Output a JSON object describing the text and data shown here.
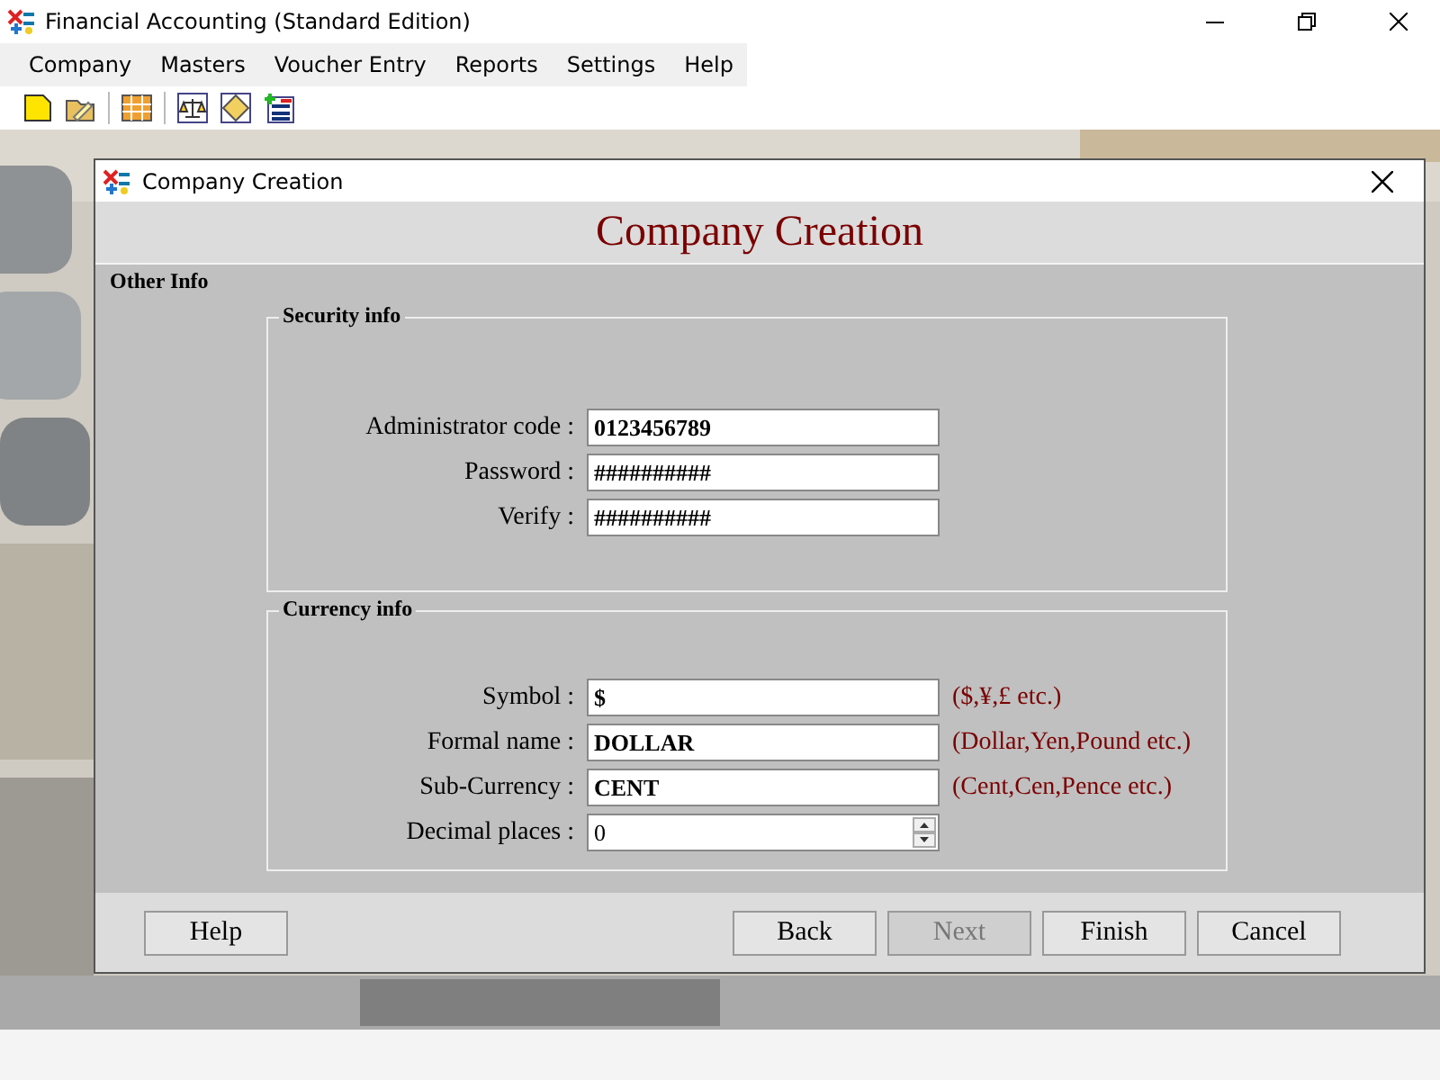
{
  "window": {
    "title": "Financial Accounting (Standard Edition)"
  },
  "menu": [
    "Company",
    "Masters",
    "Voucher Entry",
    "Reports",
    "Settings",
    "Help"
  ],
  "dialog": {
    "title": "Company Creation",
    "heading": "Company Creation",
    "section": "Other Info",
    "groups": [
      {
        "title": "Security info",
        "fields": [
          {
            "kind": "text",
            "label": "Administrator code :",
            "value": "0123456789"
          },
          {
            "kind": "text",
            "label": "Password :",
            "value": "##########"
          },
          {
            "kind": "text",
            "label": "Verify :",
            "value": "##########"
          }
        ]
      },
      {
        "title": "Currency info",
        "fields": [
          {
            "kind": "text",
            "label": "Symbol :",
            "value": "$",
            "hint": "($,¥,£ etc.)"
          },
          {
            "kind": "text",
            "label": "Formal name :",
            "value": "DOLLAR",
            "hint": "(Dollar,Yen,Pound etc.)"
          },
          {
            "kind": "text",
            "label": "Sub-Currency :",
            "value": "CENT",
            "hint": "(Cent,Cen,Pence etc.)"
          },
          {
            "kind": "spin",
            "label": "Decimal places :",
            "value": "0"
          }
        ]
      }
    ],
    "buttons": [
      {
        "label": "Help",
        "disabled": false
      },
      {
        "label": "Back",
        "disabled": false
      },
      {
        "label": "Next",
        "disabled": true
      },
      {
        "label": "Finish",
        "disabled": false
      },
      {
        "label": "Cancel",
        "disabled": false
      }
    ]
  }
}
